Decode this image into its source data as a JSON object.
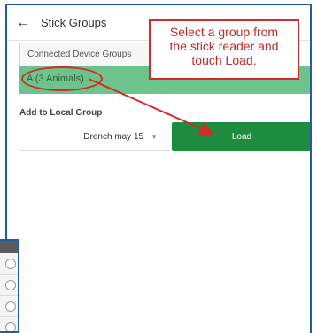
{
  "header": {
    "back_icon": "←",
    "title": "Stick Groups"
  },
  "connected_groups": {
    "tab_label": "Connected Device Groups",
    "selected_group": "A (3 Animals)"
  },
  "local_group": {
    "label": "Add to Local Group",
    "selected_value": "Drench may 15",
    "caret": "▼"
  },
  "load_button": {
    "label": "Load"
  },
  "callout": {
    "lines": [
      "Select a group from",
      "the stick reader and",
      "touch Load."
    ]
  },
  "colors": {
    "accent_green": "#1e8c3e",
    "row_green": "#6cc38b",
    "callout_red": "#d42a2a",
    "frame_blue": "#1f5fa8"
  }
}
